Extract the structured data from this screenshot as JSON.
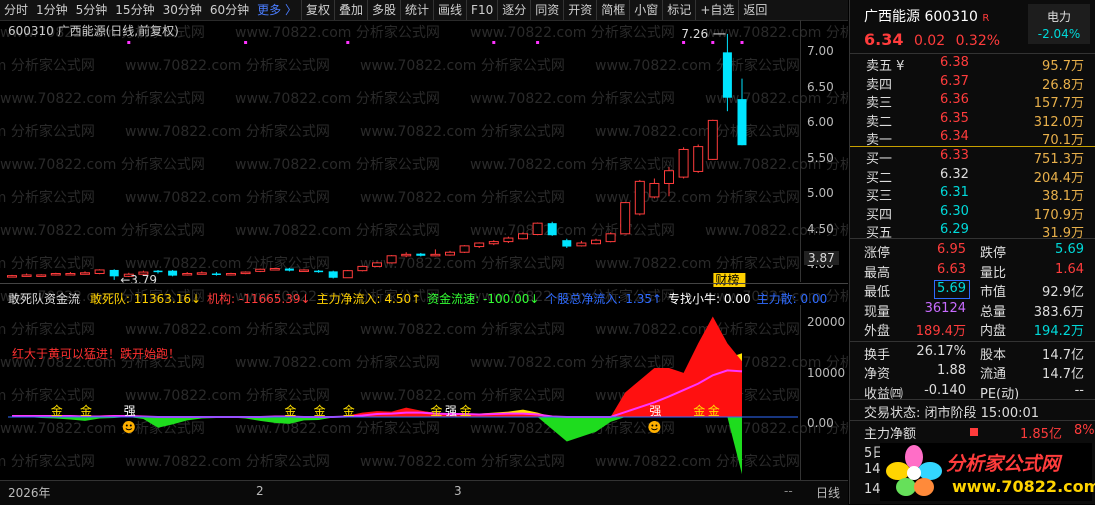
{
  "toolbar": {
    "items": [
      "分时",
      "1分钟",
      "5分钟",
      "15分钟",
      "30分钟",
      "60分钟",
      "更多 〉",
      "复权",
      "叠加",
      "多股",
      "统计",
      "画线",
      "F10",
      "逐分",
      "同资",
      "开资",
      "简框",
      "小窗",
      "标记",
      "+自选",
      "返回"
    ]
  },
  "chart": {
    "title": "600310 广西能源(日线,前复权)",
    "price_ticks": [
      "7.00",
      "6.50",
      "6.00",
      "5.50",
      "5.00",
      "4.50",
      "4.00"
    ],
    "current_price": "3.87",
    "high_label": "7.26",
    "low_label": "3.79",
    "badge": "财榜",
    "watermark": "www.70822.com 分析家公式网",
    "colors": {
      "up": "#ff3c3c",
      "down": "#00e5ff",
      "magenta": "#ff33ff"
    }
  },
  "chart_data": {
    "type": "candlestick",
    "candles": [
      {
        "o": 3.84,
        "c": 3.85,
        "h": 3.86,
        "l": 3.83
      },
      {
        "o": 3.85,
        "c": 3.86,
        "h": 3.88,
        "l": 3.84
      },
      {
        "o": 3.85,
        "c": 3.86,
        "h": 3.87,
        "l": 3.84
      },
      {
        "o": 3.86,
        "c": 3.88,
        "h": 3.89,
        "l": 3.85
      },
      {
        "o": 3.87,
        "c": 3.88,
        "h": 3.9,
        "l": 3.86
      },
      {
        "o": 3.88,
        "c": 3.89,
        "h": 3.91,
        "l": 3.87
      },
      {
        "o": 3.88,
        "c": 3.93,
        "h": 3.94,
        "l": 3.87
      },
      {
        "o": 3.93,
        "c": 3.84,
        "h": 3.94,
        "l": 3.79
      },
      {
        "o": 3.84,
        "c": 3.87,
        "h": 3.89,
        "l": 3.83
      },
      {
        "o": 3.87,
        "c": 3.9,
        "h": 3.92,
        "l": 3.86
      },
      {
        "o": 3.92,
        "c": 3.9,
        "h": 3.93,
        "l": 3.88
      },
      {
        "o": 3.92,
        "c": 3.85,
        "h": 3.93,
        "l": 3.84
      },
      {
        "o": 3.86,
        "c": 3.88,
        "h": 3.9,
        "l": 3.85
      },
      {
        "o": 3.88,
        "c": 3.89,
        "h": 3.91,
        "l": 3.87
      },
      {
        "o": 3.88,
        "c": 3.86,
        "h": 3.9,
        "l": 3.85
      },
      {
        "o": 3.86,
        "c": 3.88,
        "h": 3.89,
        "l": 3.85
      },
      {
        "o": 3.88,
        "c": 3.9,
        "h": 3.91,
        "l": 3.87
      },
      {
        "o": 3.91,
        "c": 3.94,
        "h": 3.95,
        "l": 3.9
      },
      {
        "o": 3.94,
        "c": 3.95,
        "h": 3.96,
        "l": 3.93
      },
      {
        "o": 3.95,
        "c": 3.92,
        "h": 3.96,
        "l": 3.91
      },
      {
        "o": 3.92,
        "c": 3.93,
        "h": 3.94,
        "l": 3.91
      },
      {
        "o": 3.92,
        "c": 3.91,
        "h": 3.93,
        "l": 3.89
      },
      {
        "o": 3.91,
        "c": 3.82,
        "h": 3.92,
        "l": 3.81
      },
      {
        "o": 3.82,
        "c": 3.92,
        "h": 3.93,
        "l": 3.82
      },
      {
        "o": 3.92,
        "c": 3.98,
        "h": 3.99,
        "l": 3.91
      },
      {
        "o": 3.98,
        "c": 4.03,
        "h": 4.04,
        "l": 3.97
      },
      {
        "o": 4.03,
        "c": 4.13,
        "h": 4.14,
        "l": 4.02
      },
      {
        "o": 4.13,
        "c": 4.15,
        "h": 4.18,
        "l": 4.11
      },
      {
        "o": 4.16,
        "c": 4.13,
        "h": 4.17,
        "l": 4.12
      },
      {
        "o": 4.14,
        "c": 4.15,
        "h": 4.22,
        "l": 4.12
      },
      {
        "o": 4.14,
        "c": 4.18,
        "h": 4.2,
        "l": 4.13
      },
      {
        "o": 4.18,
        "c": 4.27,
        "h": 4.28,
        "l": 4.17
      },
      {
        "o": 4.26,
        "c": 4.31,
        "h": 4.32,
        "l": 4.24
      },
      {
        "o": 4.3,
        "c": 4.33,
        "h": 4.35,
        "l": 4.28
      },
      {
        "o": 4.33,
        "c": 4.38,
        "h": 4.4,
        "l": 4.31
      },
      {
        "o": 4.37,
        "c": 4.44,
        "h": 4.46,
        "l": 4.36
      },
      {
        "o": 4.43,
        "c": 4.59,
        "h": 4.6,
        "l": 4.42
      },
      {
        "o": 4.59,
        "c": 4.42,
        "h": 4.61,
        "l": 4.41
      },
      {
        "o": 4.35,
        "c": 4.26,
        "h": 4.37,
        "l": 4.24
      },
      {
        "o": 4.27,
        "c": 4.31,
        "h": 4.34,
        "l": 4.26
      },
      {
        "o": 4.3,
        "c": 4.35,
        "h": 4.37,
        "l": 4.29
      },
      {
        "o": 4.33,
        "c": 4.44,
        "h": 4.46,
        "l": 4.32
      },
      {
        "o": 4.44,
        "c": 4.88,
        "h": 4.89,
        "l": 4.43
      },
      {
        "o": 4.72,
        "c": 5.18,
        "h": 5.2,
        "l": 4.7
      },
      {
        "o": 4.96,
        "c": 5.15,
        "h": 5.22,
        "l": 4.94
      },
      {
        "o": 5.15,
        "c": 5.33,
        "h": 5.38,
        "l": 4.97
      },
      {
        "o": 5.24,
        "c": 5.63,
        "h": 5.66,
        "l": 5.22
      },
      {
        "o": 5.32,
        "c": 5.67,
        "h": 5.7,
        "l": 5.3
      },
      {
        "o": 5.49,
        "c": 6.04,
        "h": 6.05,
        "l": 5.48
      },
      {
        "o": 7.0,
        "c": 6.36,
        "h": 7.26,
        "l": 6.17
      },
      {
        "o": 6.34,
        "c": 5.69,
        "h": 6.63,
        "l": 5.69
      }
    ]
  },
  "indicator": {
    "name": "敢死队资金流",
    "readouts": [
      {
        "label": "敢死队: 11363.16↓",
        "color": "#ffd000"
      },
      {
        "label": "机构: -11665.39↓",
        "color": "#ff3c3c"
      },
      {
        "label": "主力净流入: 4.50↑",
        "color": "#ffd000"
      },
      {
        "label": "资金流速: -100.00↓",
        "color": "#33ff33"
      },
      {
        "label": "个股总净流入: 1.35↑",
        "color": "#2f6bff"
      },
      {
        "label": "专找小牛: 0.00",
        "color": "#ffffff"
      },
      {
        "label": "主力散: 0.00",
        "color": "#2f6bff"
      }
    ],
    "ticks": [
      "20000",
      "10000",
      "0.00"
    ],
    "note": "红大于黄可以猛进！跌开始跑！",
    "gold_label": "金",
    "strong_label": "强"
  },
  "xaxis": {
    "labels": [
      "2026年",
      "2",
      "3"
    ],
    "period": "日线",
    "arrow": "--"
  },
  "quote": {
    "name": "广西能源",
    "code": "600310",
    "flag": "R",
    "sector": "电力",
    "sector_chg": "-2.04%",
    "price": "6.34",
    "change": "0.02",
    "pct": "0.32%",
    "asks": [
      {
        "label": "卖五 ¥",
        "price": "6.38",
        "vol": "95.7万"
      },
      {
        "label": "卖四",
        "price": "6.37",
        "vol": "26.8万"
      },
      {
        "label": "卖三",
        "price": "6.36",
        "vol": "157.7万"
      },
      {
        "label": "卖二",
        "price": "6.35",
        "vol": "312.0万"
      },
      {
        "label": "卖一",
        "price": "6.34",
        "vol": "70.1万"
      }
    ],
    "bids": [
      {
        "label": "买一",
        "price": "6.33",
        "vol": "751.3万"
      },
      {
        "label": "买二",
        "price": "6.32",
        "vol": "204.4万"
      },
      {
        "label": "买三",
        "price": "6.31",
        "vol": "38.1万"
      },
      {
        "label": "买四",
        "price": "6.30",
        "vol": "170.9万"
      },
      {
        "label": "买五",
        "price": "6.29",
        "vol": "31.9万"
      }
    ],
    "stats": {
      "zt_l": "涨停",
      "zt": "6.95",
      "dt_l": "跌停",
      "dt": "5.69",
      "zg_l": "最高",
      "zg": "6.63",
      "lb_l": "量比",
      "lb": "1.64",
      "zd_l": "最低",
      "zd": "5.69",
      "sz_l": "市值",
      "sz": "92.9亿",
      "xl_l": "现量",
      "xl": "36124",
      "zl_l": "总量",
      "zl": "383.6万",
      "wp_l": "外盘",
      "wp": "189.4万",
      "np_l": "内盘",
      "np": "194.2万",
      "hs_l": "换手",
      "hs": "26.17%",
      "gb_l": "股本",
      "gb": "14.7亿",
      "jz_l": "净资",
      "jz": "1.88",
      "lt_l": "流通",
      "lt": "14.7亿",
      "sy_l": "收益㈣",
      "sy": "-0.140",
      "pe_l": "PE(动)",
      "pe": "--"
    },
    "status": "交易状态: 闭市阶段 15:00:01",
    "net_l": "主力净额",
    "net": "1.85亿",
    "net_pct": "8%",
    "net5_l": "5日",
    "row14a": "14",
    "row14b": "14"
  },
  "logo": {
    "text": "分析家公式网",
    "url": "www.70822.com"
  }
}
